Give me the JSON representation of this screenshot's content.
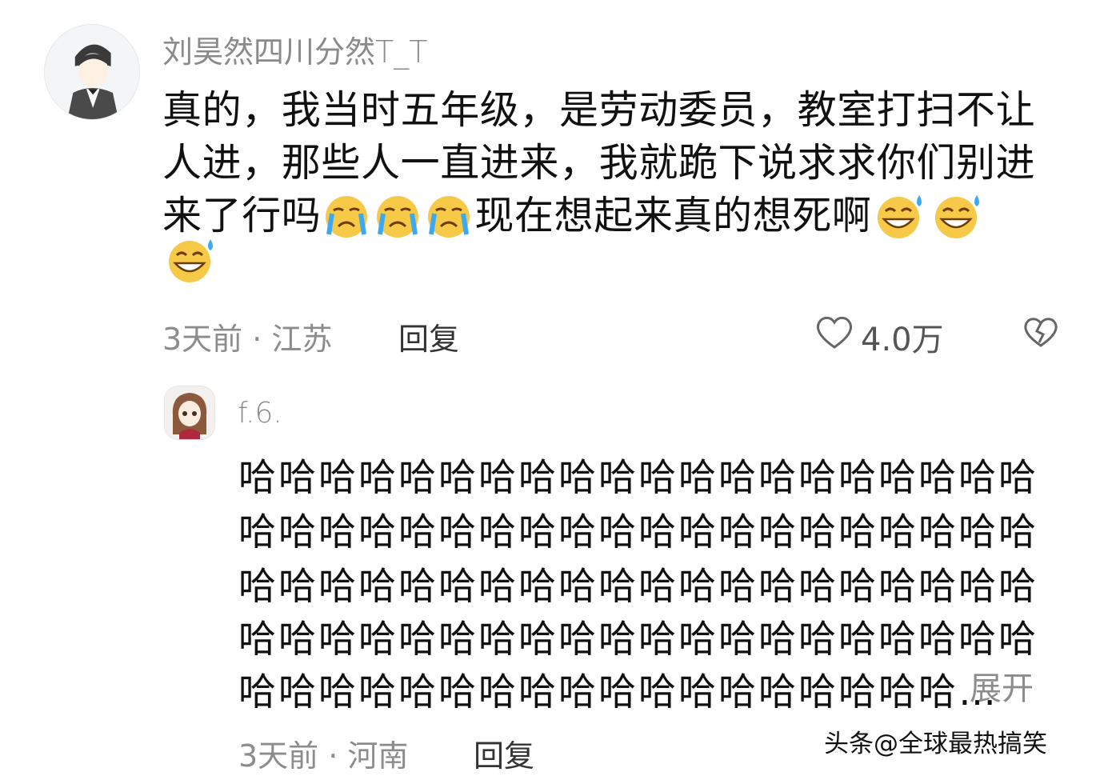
{
  "comment": {
    "username": "刘昊然四川分然T_T",
    "body": {
      "line1": "真的，我当时五年级，是劳动委员，教室打扫不让",
      "line2": "人进，那些人一直进来，我就跪下说求求你们别进",
      "line3_start": "来了行吗",
      "line3_middle": "现在想起来真的想死啊"
    },
    "meta": "3天前 · 江苏",
    "reply_label": "回复",
    "likes": "4.0万"
  },
  "reply": {
    "username": "f.6.",
    "lines": [
      "哈哈哈哈哈哈哈哈哈哈哈哈哈哈哈哈哈哈哈哈",
      "哈哈哈哈哈哈哈哈哈哈哈哈哈哈哈哈哈哈哈哈",
      "哈哈哈哈哈哈哈哈哈哈哈哈哈哈哈哈哈哈哈哈",
      "哈哈哈哈哈哈哈哈哈哈哈哈哈哈哈哈哈哈哈哈",
      "哈哈哈哈哈哈哈哈哈哈哈哈哈哈哈哈哈哈…"
    ],
    "expand_label": "展开",
    "meta": "3天前 · 河南",
    "reply_label": "回复"
  },
  "watermark": "头条@全球最热搞笑",
  "colors": {
    "text": "#111111",
    "muted": "#8c8c8c",
    "emoji_face": "#f7c948",
    "emoji_tear": "#3da9f5"
  }
}
